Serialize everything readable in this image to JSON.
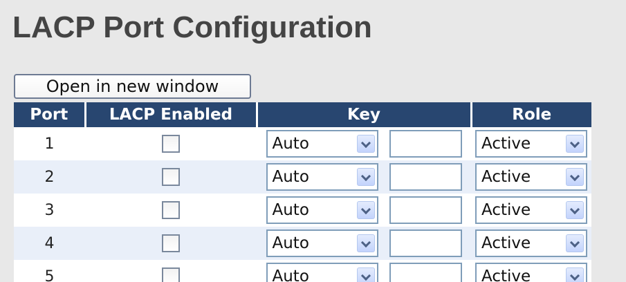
{
  "page": {
    "title": "LACP Port Configuration",
    "open_button_label": "Open in new window"
  },
  "table": {
    "headers": {
      "port": "Port",
      "lacp_enabled": "LACP Enabled",
      "key": "Key",
      "role": "Role"
    },
    "rows": [
      {
        "port": "1",
        "lacp_enabled": false,
        "key_mode": "Auto",
        "key_value": "",
        "role": "Active"
      },
      {
        "port": "2",
        "lacp_enabled": false,
        "key_mode": "Auto",
        "key_value": "",
        "role": "Active"
      },
      {
        "port": "3",
        "lacp_enabled": false,
        "key_mode": "Auto",
        "key_value": "",
        "role": "Active"
      },
      {
        "port": "4",
        "lacp_enabled": false,
        "key_mode": "Auto",
        "key_value": "",
        "role": "Active"
      },
      {
        "port": "5",
        "lacp_enabled": false,
        "key_mode": "Auto",
        "key_value": "",
        "role": "Active"
      }
    ]
  },
  "colors": {
    "header_bg": "#284670",
    "row_alt_bg": "#e9eff9",
    "page_bg": "#e8e8e8"
  },
  "icons": {
    "dropdown": "chevron-down-icon"
  }
}
